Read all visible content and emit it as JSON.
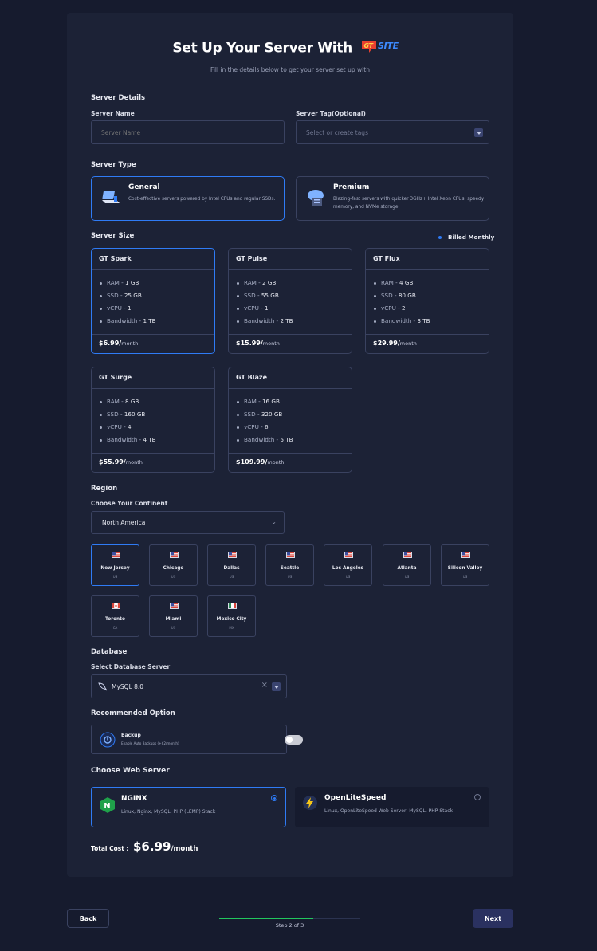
{
  "header": {
    "title": "Set Up Your Server With",
    "logo_text": "GT SITE",
    "subtitle": "Fill in the details below to get your server set up with"
  },
  "server_details": {
    "heading": "Server Details",
    "name_label": "Server Name",
    "name_placeholder": "Server Name",
    "tag_label": "Server Tag(Optional)",
    "tag_placeholder": "Select or create tags"
  },
  "server_type": {
    "heading": "Server Type",
    "options": [
      {
        "title": "General",
        "desc": "Cost-effective servers powered by Intel CPUs and regular SSDs.",
        "selected": true
      },
      {
        "title": "Premium",
        "desc": "Blazing-fast servers with quicker 3GHz+ Intel Xeon CPUs, speedy memory, and NVMe storage.",
        "selected": false
      }
    ]
  },
  "server_size": {
    "heading": "Server Size",
    "billing": "Billed Monthly",
    "plans": [
      {
        "name": "GT Spark",
        "ram": "1 GB",
        "ssd": "25 GB",
        "vcpu": "1",
        "bandwidth": "1 TB",
        "price": "$6.99/",
        "period": "month",
        "selected": true
      },
      {
        "name": "GT Pulse",
        "ram": "2 GB",
        "ssd": "55 GB",
        "vcpu": "1",
        "bandwidth": "2 TB",
        "price": "$15.99/",
        "period": "month",
        "selected": false
      },
      {
        "name": "GT Flux",
        "ram": "4 GB",
        "ssd": "80 GB",
        "vcpu": "2",
        "bandwidth": "3 TB",
        "price": "$29.99/",
        "period": "month",
        "selected": false
      },
      {
        "name": "GT Surge",
        "ram": "8 GB",
        "ssd": "160 GB",
        "vcpu": "4",
        "bandwidth": "4 TB",
        "price": "$55.99/",
        "period": "month",
        "selected": false
      },
      {
        "name": "GT Blaze",
        "ram": "16 GB",
        "ssd": "320 GB",
        "vcpu": "6",
        "bandwidth": "5 TB",
        "price": "$109.99/",
        "period": "month",
        "selected": false
      }
    ],
    "spec_labels": {
      "ram": "RAM - ",
      "ssd": "SSD - ",
      "vcpu": "vCPU - ",
      "bandwidth": "Bandwidth - "
    }
  },
  "region": {
    "heading": "Region",
    "continent_label": "Choose Your Continent",
    "continent_value": "North America",
    "locations": [
      {
        "name": "New Jersey",
        "code": "US",
        "selected": true
      },
      {
        "name": "Chicago",
        "code": "US",
        "selected": false
      },
      {
        "name": "Dallas",
        "code": "US",
        "selected": false
      },
      {
        "name": "Seattle",
        "code": "US",
        "selected": false
      },
      {
        "name": "Los Angeles",
        "code": "US",
        "selected": false
      },
      {
        "name": "Atlanta",
        "code": "US",
        "selected": false
      },
      {
        "name": "Silicon Valley",
        "code": "US",
        "selected": false
      },
      {
        "name": "Toronto",
        "code": "CA",
        "selected": false
      },
      {
        "name": "Miami",
        "code": "US",
        "selected": false
      },
      {
        "name": "Mexico City",
        "code": "MX",
        "selected": false
      }
    ]
  },
  "database": {
    "heading": "Database",
    "label": "Select Database Server",
    "value": "MySQL 8.0",
    "clear": "×"
  },
  "recommended": {
    "heading": "Recommended Option",
    "backup_title": "Backup",
    "backup_desc": "Enable Auto Backups (+$2/month)",
    "enabled": false
  },
  "web_server": {
    "heading": "Choose Web Server",
    "options": [
      {
        "title": "NGINX",
        "desc": "Linux, Nginx, MySQL, PHP (LEMP) Stack",
        "selected": true
      },
      {
        "title": "OpenLiteSpeed",
        "desc": "Linux, OpenLiteSpeed Web Server, MySQL, PHP Stack",
        "selected": false
      }
    ]
  },
  "total": {
    "label": "Total Cost :",
    "amount": "$6.99",
    "period": "/month"
  },
  "footer": {
    "back": "Back",
    "next": "Next",
    "step": "Step 2 of 3",
    "progress": 0.667
  },
  "colors": {
    "accent": "#2f7bf5",
    "progress": "#22c55e",
    "background": "#161b2e",
    "card": "#1c2236"
  }
}
